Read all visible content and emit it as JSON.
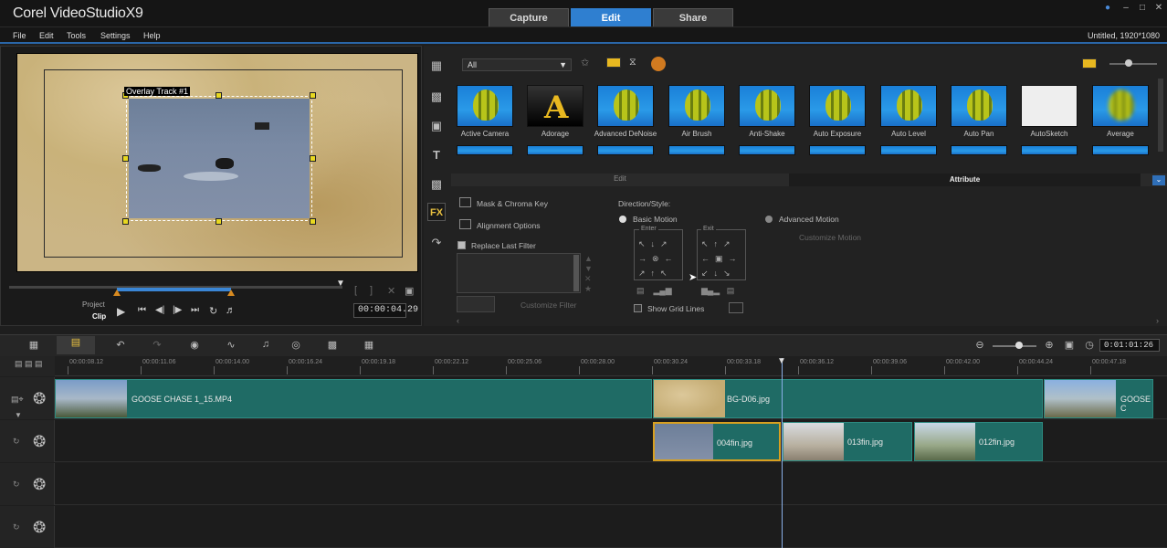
{
  "app": {
    "logo": "Corel VideoStudioX9",
    "tabs": [
      "Capture",
      "Edit",
      "Share"
    ],
    "active_tab": "Edit",
    "project": "Untitled, 1920*1080"
  },
  "menu": [
    "File",
    "Edit",
    "Tools",
    "Settings",
    "Help"
  ],
  "preview": {
    "overlay_label": "Overlay Track #1",
    "project_label": "Project",
    "clip_label": "Clip",
    "timecode": "00:00:04.29"
  },
  "library": {
    "filter": "All",
    "effects": [
      {
        "name": "Active Camera"
      },
      {
        "name": "Adorage"
      },
      {
        "name": "Advanced DeNoise"
      },
      {
        "name": "Air Brush"
      },
      {
        "name": "Anti-Shake"
      },
      {
        "name": "Auto Exposure"
      },
      {
        "name": "Auto Level"
      },
      {
        "name": "Auto Pan"
      },
      {
        "name": "AutoSketch"
      },
      {
        "name": "Average"
      }
    ]
  },
  "attributes": {
    "tabs": [
      "Edit",
      "Attribute"
    ],
    "active": "Attribute",
    "mask": "Mask & Chroma Key",
    "align": "Alignment Options",
    "replace": "Replace Last Filter",
    "customize_filter": "Customize Filter",
    "direction_style": "Direction/Style:",
    "basic_motion": "Basic Motion",
    "advanced_motion": "Advanced Motion",
    "customize_motion": "Customize Motion",
    "enter": "Enter",
    "exit": "Exit",
    "show_grid": "Show Grid Lines"
  },
  "timeline": {
    "timecode": "0:01:01:26",
    "ruler": [
      "00:00:08.12",
      "00:00:11.06",
      "00:00:14.00",
      "00:00:16.24",
      "00:00:19.18",
      "00:00:22.12",
      "00:00:25.06",
      "00:00:28.00",
      "00:00:30.24",
      "00:00:33.18",
      "00:00:36.12",
      "00:00:39.06",
      "00:00:42.00",
      "00:00:44.24",
      "00:00:47.18"
    ],
    "video_clips": [
      "GOOSE CHASE 1_15.MP4",
      "BG-D06.jpg",
      "GOOSE C"
    ],
    "overlay_clips": [
      "004fin.jpg",
      "013fin.jpg",
      "012fin.jpg"
    ]
  },
  "colors": {
    "accent": "#2f7fd0",
    "clip": "#1f6b65",
    "handle": "#e8d820"
  }
}
